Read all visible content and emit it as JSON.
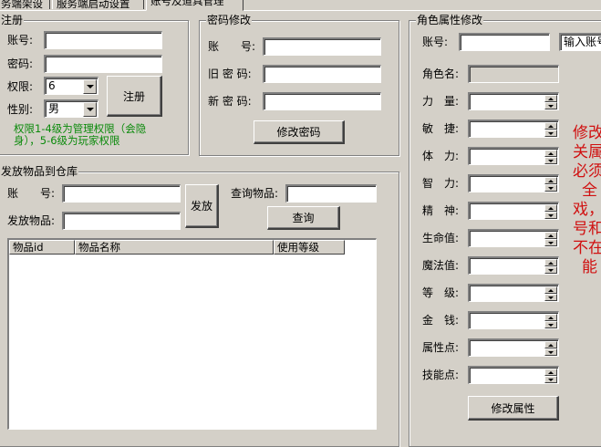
{
  "tabs": [
    {
      "label": "务端架设"
    },
    {
      "label": "服务端启动设置"
    },
    {
      "label": "账号及道具管理"
    }
  ],
  "register": {
    "title": "注册",
    "account_label": "账号:",
    "account_value": "",
    "password_label": "密码:",
    "password_value": "",
    "permission_label": "权限:",
    "permission_value": "6",
    "gender_label": "性别:",
    "gender_value": "男",
    "register_button": "注册",
    "note": "权限1-4级为管理权限（会隐身），5-6级为玩家权限"
  },
  "password_change": {
    "title": "密码修改",
    "account_label": "账　　号:",
    "account_value": "",
    "old_label": "旧 密 码:",
    "old_value": "",
    "new_label": "新 密 码:",
    "new_value": "",
    "button": "修改密码"
  },
  "item_distribution": {
    "title": "发放物品到仓库",
    "account_label": "账　　号:",
    "account_value": "",
    "item_label": "发放物品:",
    "item_value": "",
    "send_button": "发放",
    "query_label": "查询物品:",
    "query_value": "",
    "query_button": "查询",
    "columns": [
      {
        "label": "物品id"
      },
      {
        "label": "物品名称"
      },
      {
        "label": "使用等级"
      }
    ]
  },
  "role_attributes": {
    "title": "角色属性修改",
    "account_label": "账号:",
    "account_value": "",
    "account_placeholder": "输入账号",
    "role_name_label": "角色名:",
    "role_name_value": "",
    "stats": [
      {
        "label": "力　量:",
        "value": ""
      },
      {
        "label": "敏　捷:",
        "value": ""
      },
      {
        "label": "体　力:",
        "value": ""
      },
      {
        "label": "智　力:",
        "value": ""
      },
      {
        "label": "精　神:",
        "value": ""
      },
      {
        "label": "生命值:",
        "value": ""
      },
      {
        "label": "魔法值:",
        "value": ""
      },
      {
        "label": "等　级:",
        "value": ""
      },
      {
        "label": "金　钱:",
        "value": ""
      },
      {
        "label": "属性点:",
        "value": ""
      },
      {
        "label": "技能点:",
        "value": ""
      }
    ],
    "button": "修改属性",
    "warning_lines": [
      "修改",
      "关属",
      "必须",
      "全",
      "戏，",
      "号和",
      "不在",
      "能"
    ]
  },
  "colors": {
    "background": "#d4d0c8",
    "note_green": "#0b8a0b",
    "warning_red": "#d01010"
  }
}
